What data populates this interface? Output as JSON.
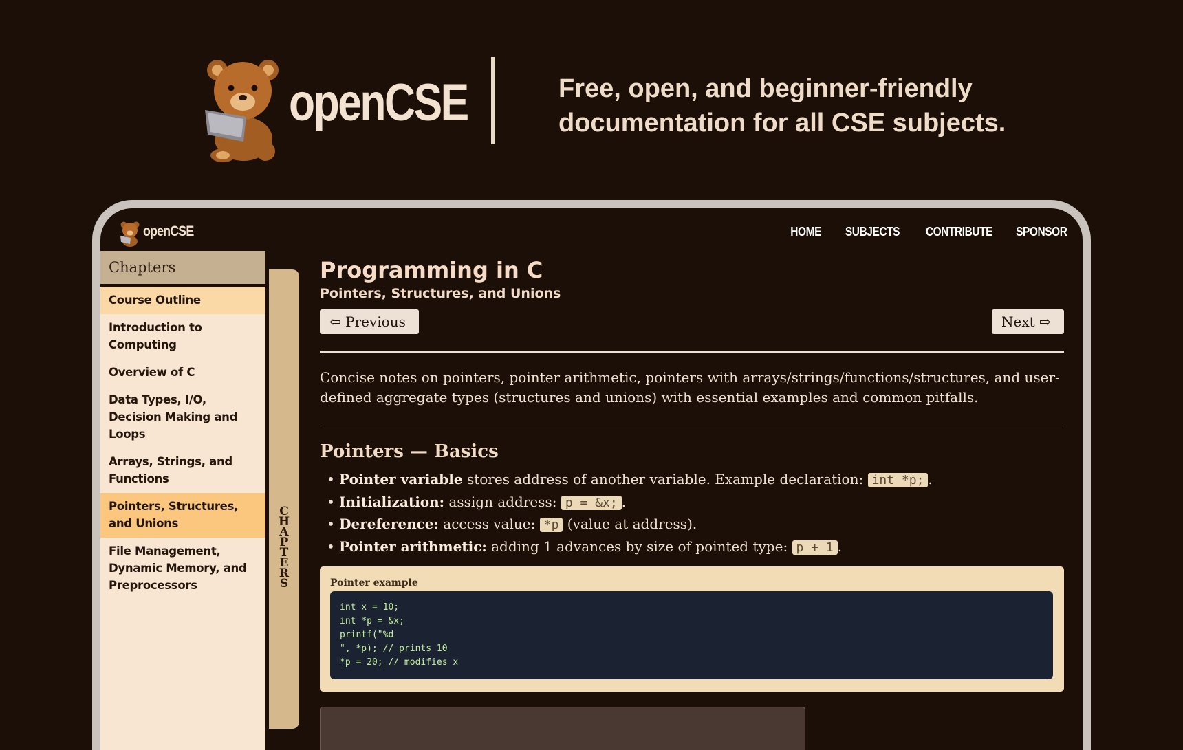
{
  "hero": {
    "brand": "openCSE",
    "tagline_line1": "Free, open, and beginner-friendly",
    "tagline_line2": "documentation for all CSE subjects."
  },
  "topbar": {
    "brand": "openCSE",
    "nav": [
      "HOME",
      "SUBJECTS",
      "CONTRIBUTE",
      "SPONSOR"
    ]
  },
  "sidebar": {
    "heading": "Chapters",
    "items": [
      "Course Outline",
      "Introduction to Computing",
      "Overview of C",
      "Data Types, I/O, Decision Making and Loops",
      "Arrays, Strings, and Functions",
      "Pointers, Structures, and Unions",
      "File Management, Dynamic Memory, and Preprocessors"
    ],
    "tab_label": "CHAPTERS"
  },
  "main": {
    "title": "Programming in C",
    "subtitle": "Pointers, Structures, and Unions",
    "prev_label": "Previous",
    "next_label": "Next",
    "intro": "Concise notes on pointers, pointer arithmetic, pointers with arrays/strings/functions/structures, and user-defined aggregate types (structures and unions) with essential examples and common pitfalls.",
    "section_heading": "Pointers — Basics",
    "bullets": [
      {
        "term": "Pointer variable",
        "text": " stores address of another variable. Example declaration: ",
        "code": "int *p;",
        "after": "."
      },
      {
        "term": "Initialization:",
        "text": " assign address: ",
        "code": "p = &x;",
        "after": "."
      },
      {
        "term": "Dereference:",
        "text": " access value: ",
        "code": "*p",
        "after": " (value at address)."
      },
      {
        "term": "Pointer arithmetic:",
        "text": " adding 1 advances by size of pointed type: ",
        "code": "p + 1",
        "after": "."
      }
    ],
    "example_label": "Pointer example",
    "code": "int x = 10;\nint *p = &x;\nprintf(\"%d\n\", *p); // prints 10\n*p = 20; // modifies x"
  },
  "colors": {
    "background": "#1b0f07",
    "sidebar": "#f8e6d3",
    "active_item": "#fbc77f",
    "code_bg": "#1b2333",
    "code_text": "#c4ef9a"
  }
}
